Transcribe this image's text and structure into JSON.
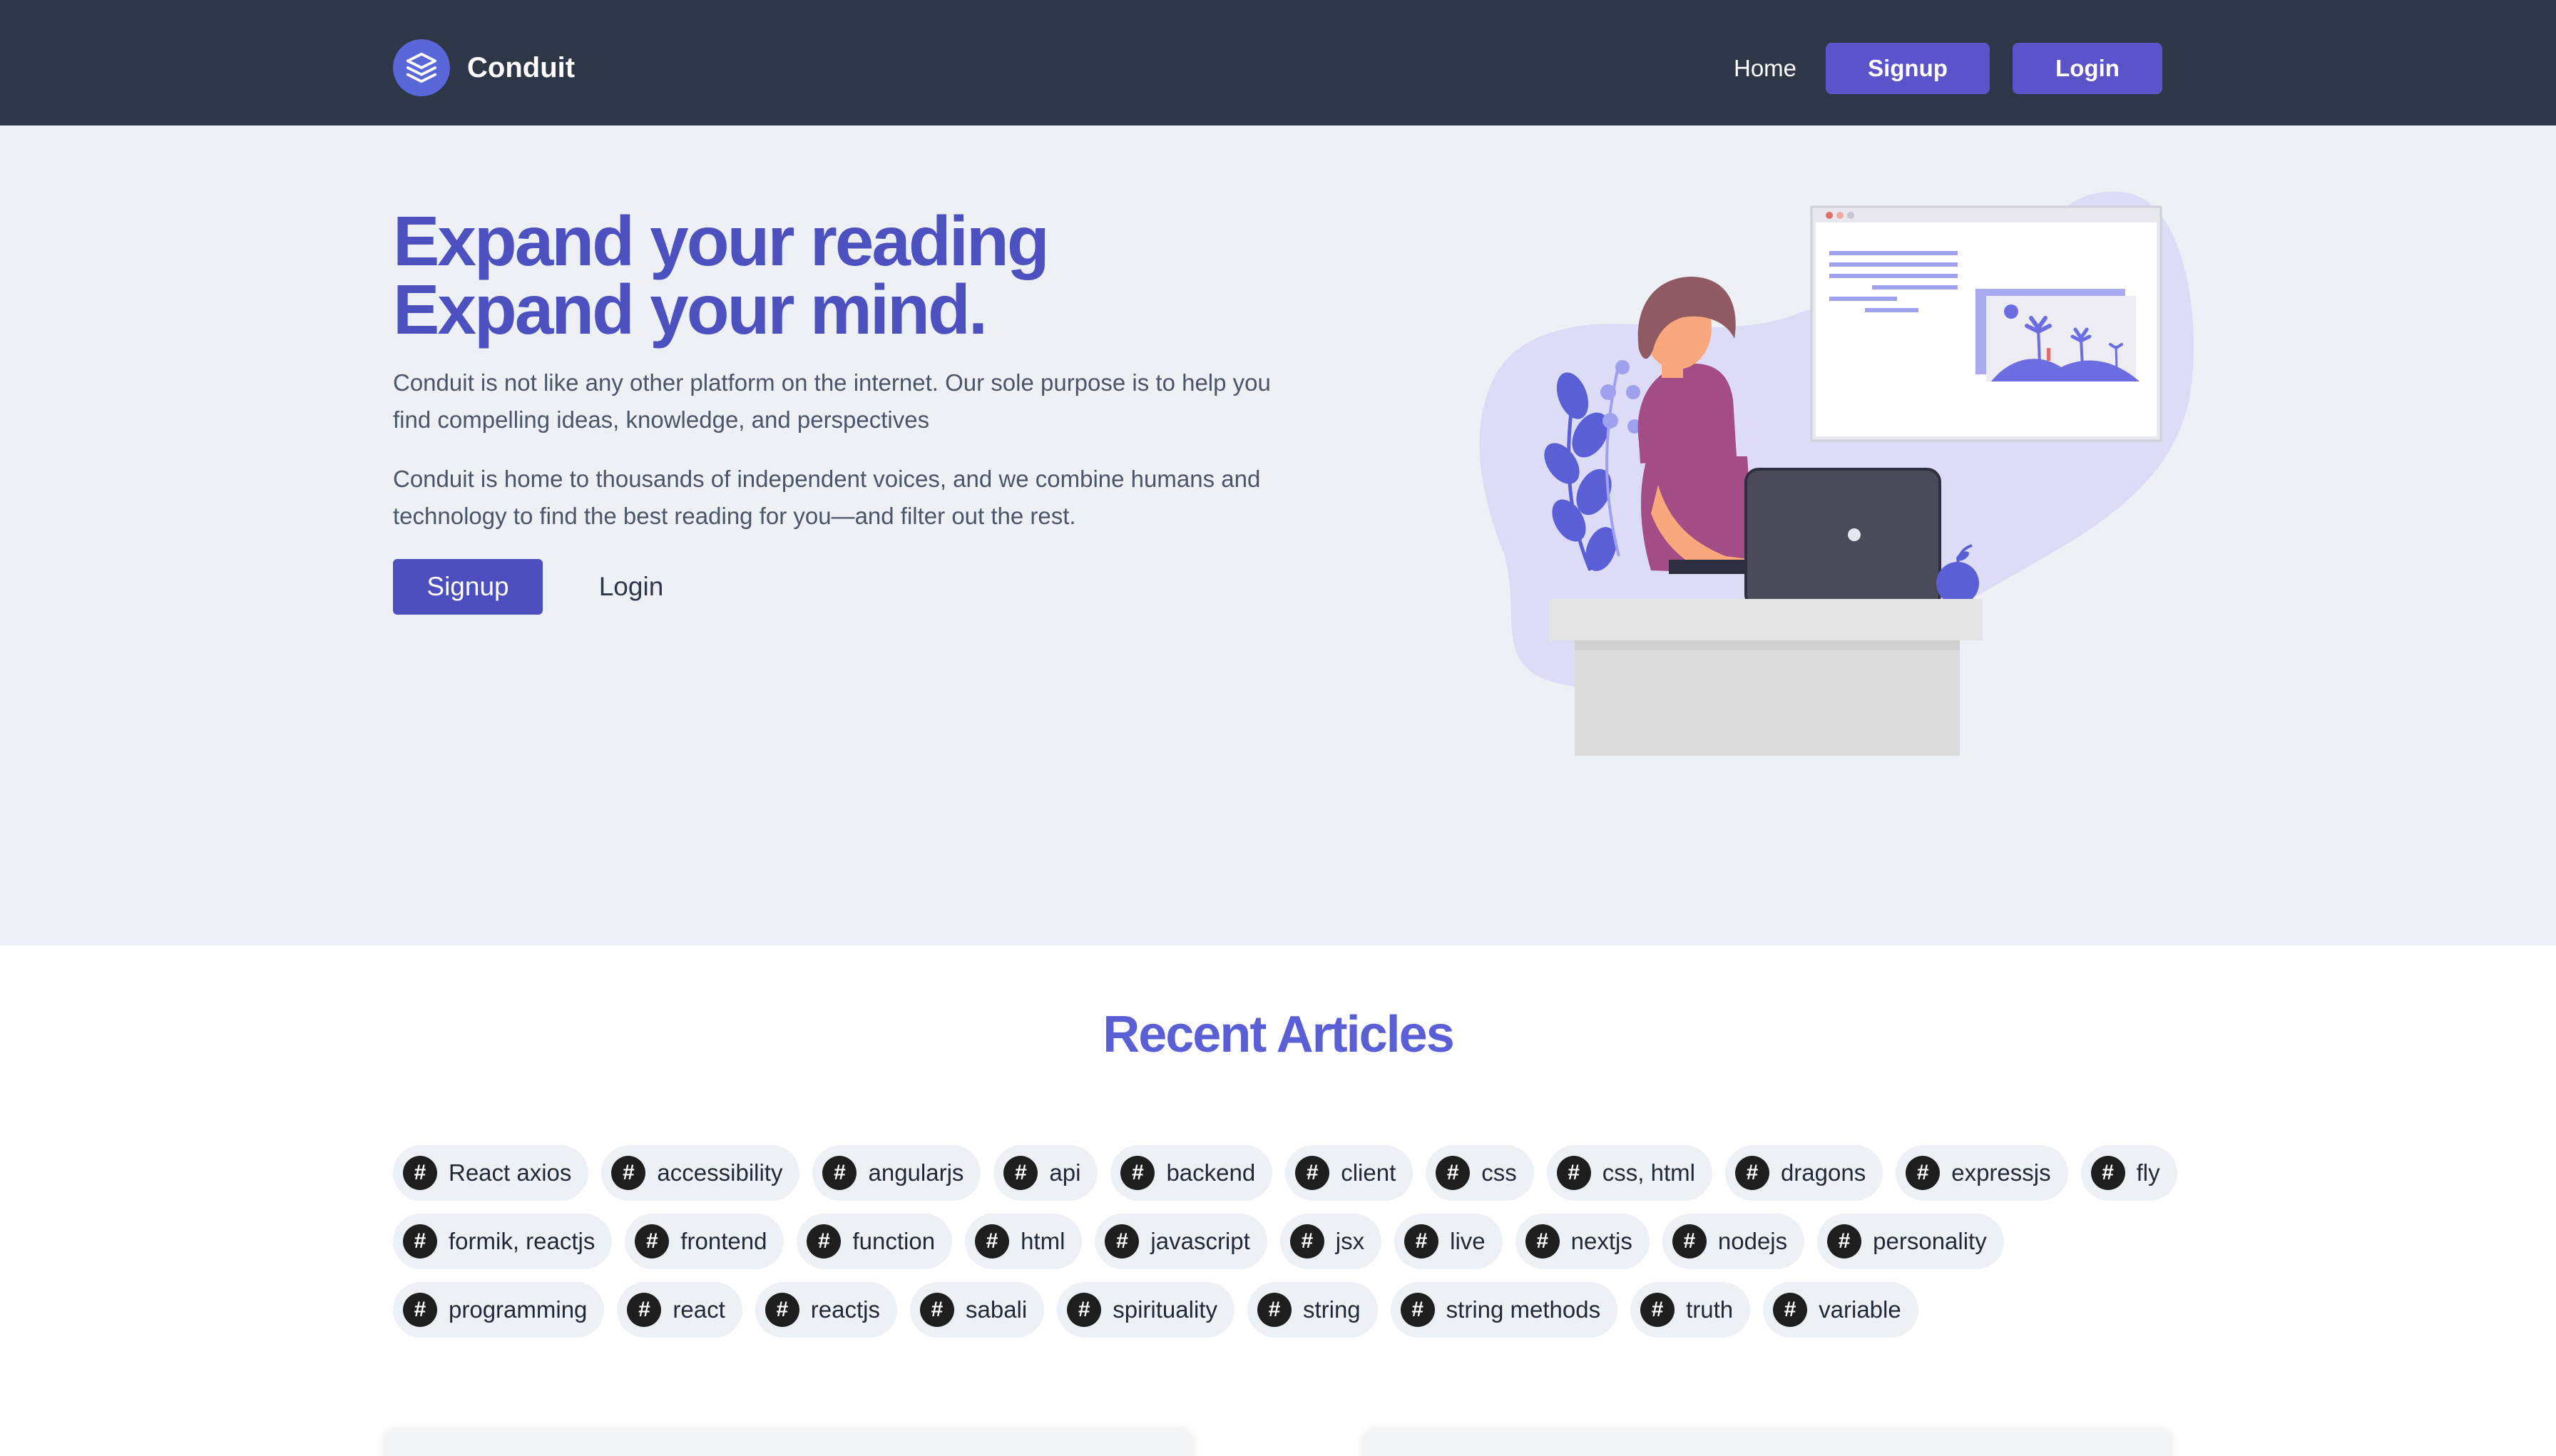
{
  "nav": {
    "brand": "Conduit",
    "home": "Home",
    "signup": "Signup",
    "login": "Login"
  },
  "hero": {
    "title_line1": "Expand your reading",
    "title_line2": "Expand your mind.",
    "paragraph1": "Conduit is not like any other platform on the internet. Our sole purpose is to help you find compelling ideas, knowledge, and perspectives",
    "paragraph2": "Conduit is home to thousands of independent voices, and we combine humans and technology to find the best reading for you—and filter out the rest.",
    "signup": "Signup",
    "login": "Login"
  },
  "articles": {
    "title": "Recent Articles",
    "tag_symbol": "#",
    "tags_row1": [
      "React axios",
      "accessibility",
      "angularjs",
      "api",
      "backend",
      "client",
      "css",
      "css, html",
      "dragons",
      "expressjs",
      "fly"
    ],
    "tags_row2": [
      "formik, reactjs",
      "frontend",
      "function",
      "html",
      "javascript",
      "jsx",
      "live",
      "nextjs",
      "nodejs",
      "personality"
    ],
    "tags_row3": [
      "programming",
      "react",
      "reactjs",
      "sabali",
      "spirituality",
      "string",
      "string methods",
      "truth",
      "variable"
    ]
  },
  "colors": {
    "nav_bg": "#2d3748",
    "accent": "#5a53c9",
    "hero_bg": "#edf1f6",
    "title": "#4c51bf"
  },
  "icons": {
    "brand": "layers-icon",
    "tag": "hash-icon"
  }
}
